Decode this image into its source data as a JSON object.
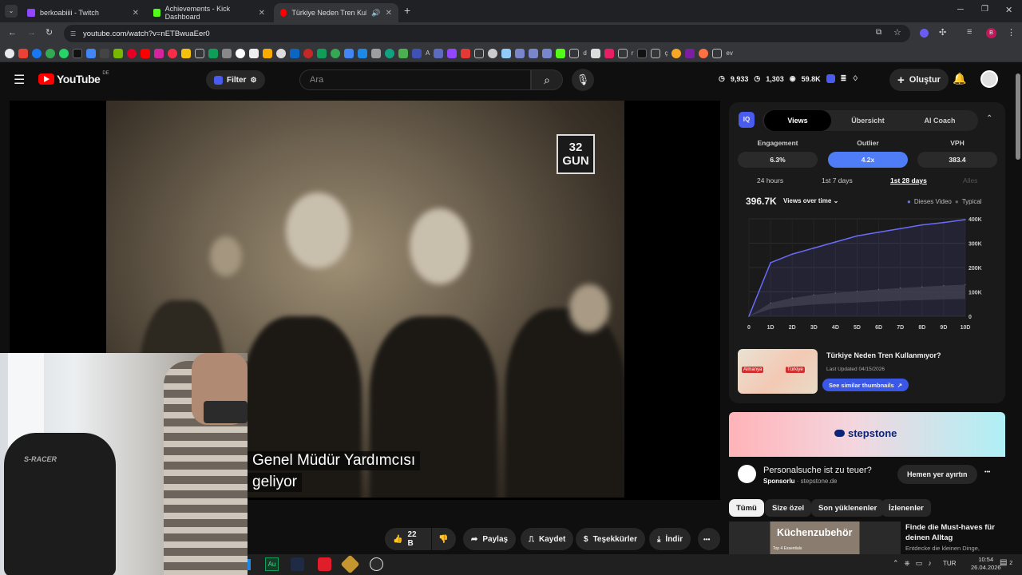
{
  "browser": {
    "tabs": [
      {
        "title": "berkoabiiii - Twitch",
        "color": "#9146ff"
      },
      {
        "title": "Achievements - Kick Dashboard",
        "color": "#53fc18"
      },
      {
        "title": "Türkiye Neden Tren Kullann",
        "color": "#ff0000"
      }
    ],
    "new_tab": "+",
    "url": "youtube.com/watch?v=nETBwuaEer0",
    "bookmarks": [
      "A",
      "d",
      "r",
      "ç",
      "ev"
    ]
  },
  "youtube": {
    "logo": "YouTube",
    "region": "DE",
    "filter": "Filter",
    "search_placeholder": "Ara",
    "stats": {
      "a": "9,933",
      "b": "1,303",
      "c": "59.8K"
    },
    "create": "Oluştur"
  },
  "video": {
    "channel_tag_line1": "32",
    "channel_tag_line2": "GUN",
    "subtitle_line1": "Genel Müdür Yardımcısı",
    "subtitle_line2": "geliyor"
  },
  "actions": {
    "likes": "22 B",
    "share": "Paylaş",
    "save": "Kaydet",
    "thanks": "Teşekkürler",
    "download": "İndir",
    "more": "•••"
  },
  "iq": {
    "badge": "IQ",
    "tabs": [
      "Views",
      "Übersicht",
      "AI Coach"
    ],
    "metrics": [
      {
        "label": "Engagement",
        "value": "6.3%"
      },
      {
        "label": "Outlier",
        "value": "4.2x"
      },
      {
        "label": "VPH",
        "value": "383.4"
      }
    ],
    "ranges": [
      "24 hours",
      "1st 7 days",
      "1st 28 days",
      "Alles"
    ],
    "total": "396.7K",
    "views_dropdown": "Views over time",
    "legend_video": "Dieses Video",
    "legend_typical": "Typical",
    "thumb_title": "Türkiye Neden Tren Kullanmıyor?",
    "thumb_date": "Last Updated 04/15/2026",
    "thumb_label_left": "Almanya",
    "thumb_label_right": "Türkiye",
    "similar_btn": "See similar thumbnails"
  },
  "chart_data": {
    "type": "line",
    "x": [
      "0",
      "1D",
      "2D",
      "3D",
      "4D",
      "5D",
      "6D",
      "7D",
      "8D",
      "9D",
      "10D"
    ],
    "yticks": [
      "400K",
      "300K",
      "200K",
      "100K",
      "0"
    ],
    "ylim": [
      0,
      400000
    ],
    "series": [
      {
        "name": "Dieses Video",
        "values": [
          0,
          220000,
          255000,
          280000,
          305000,
          330000,
          345000,
          360000,
          375000,
          385000,
          396700
        ],
        "color": "#6a6cf7"
      },
      {
        "name": "Typical",
        "values": [
          0,
          55000,
          75000,
          88000,
          96000,
          103000,
          110000,
          116000,
          121000,
          126000,
          130000
        ]
      }
    ]
  },
  "ad": {
    "brand": "stepstone",
    "title": "Personalsuche ist zu teuer?",
    "sponsored": "Sponsorlu",
    "domain": "stepstone.de",
    "cta": "Hemen yer ayırtın",
    "more": "•••"
  },
  "chips": [
    "Tümü",
    "Size özel",
    "Son yüklenenler",
    "İzlenenler"
  ],
  "rec": {
    "thumb_text": "Küchenzubehör",
    "thumb_sub": "Top 4 Essentials",
    "title": "Finde die Must-haves für deinen Alltag",
    "desc": "Entdecke die kleinen Dinge,"
  },
  "taskbar": {
    "lang": "TUR",
    "time": "10:54",
    "date": "26.04.2026",
    "notif": "2",
    "app_au": "Au"
  },
  "webcam_text": "S-RACER"
}
